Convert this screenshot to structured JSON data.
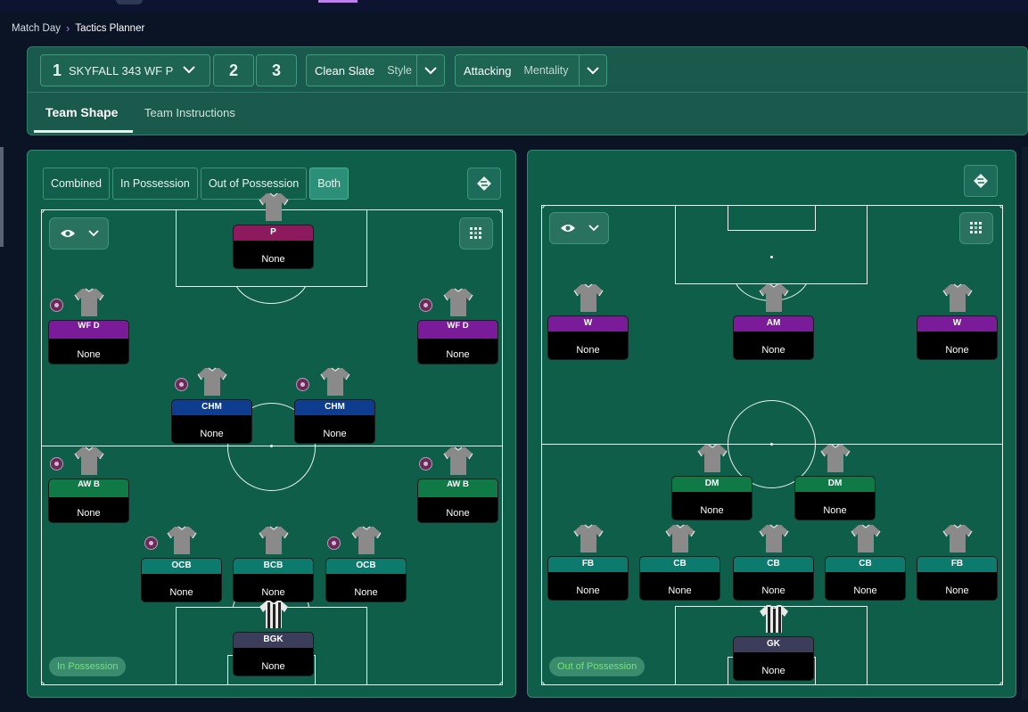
{
  "breadcrumb": {
    "parent": "Match Day",
    "current": "Tactics Planner"
  },
  "tactics": {
    "active_number": "1",
    "active_name": "SKYFALL 343 WF P",
    "slot2": "2",
    "slot3": "3",
    "style_value": "Clean Slate",
    "style_label": "Style",
    "mentality_value": "Attacking",
    "mentality_label": "Mentality"
  },
  "tabs": {
    "team_shape": "Team Shape",
    "team_instructions": "Team Instructions"
  },
  "view_modes": [
    "Combined",
    "In Possession",
    "Out of Possession",
    "Both"
  ],
  "active_view_mode": "Both",
  "left_pitch": {
    "label": "In Possession",
    "players": [
      {
        "role": "P",
        "name": "None",
        "color": "#8e1a5e"
      },
      {
        "role": "WF D",
        "name": "None",
        "color": "#7a1c9a",
        "badge": true
      },
      {
        "role": "WF D",
        "name": "None",
        "color": "#7a1c9a",
        "badge": true
      },
      {
        "role": "CHM",
        "name": "None",
        "color": "#0e3d8f",
        "badge": true
      },
      {
        "role": "CHM",
        "name": "None",
        "color": "#0e3d8f",
        "badge": true
      },
      {
        "role": "AW B",
        "name": "None",
        "color": "#0f7a46",
        "badge": true
      },
      {
        "role": "AW B",
        "name": "None",
        "color": "#0f7a46",
        "badge": true
      },
      {
        "role": "OCB",
        "name": "None",
        "color": "#0c7b6d",
        "badge": true
      },
      {
        "role": "BCB",
        "name": "None",
        "color": "#0c7b6d"
      },
      {
        "role": "OCB",
        "name": "None",
        "color": "#0c7b6d",
        "badge": true
      },
      {
        "role": "BGK",
        "name": "None",
        "color": "#3c3d5a"
      }
    ]
  },
  "right_pitch": {
    "label": "Out of Possession",
    "players": [
      {
        "role": "W",
        "name": "None",
        "color": "#7a1c9a"
      },
      {
        "role": "AM",
        "name": "None",
        "color": "#7a1c9a"
      },
      {
        "role": "W",
        "name": "None",
        "color": "#7a1c9a"
      },
      {
        "role": "DM",
        "name": "None",
        "color": "#0f7a46"
      },
      {
        "role": "DM",
        "name": "None",
        "color": "#0f7a46"
      },
      {
        "role": "FB",
        "name": "None",
        "color": "#0c7b6d"
      },
      {
        "role": "CB",
        "name": "None",
        "color": "#0c7b6d"
      },
      {
        "role": "CB",
        "name": "None",
        "color": "#0c7b6d"
      },
      {
        "role": "CB",
        "name": "None",
        "color": "#0c7b6d"
      },
      {
        "role": "FB",
        "name": "None",
        "color": "#0c7b6d"
      },
      {
        "role": "GK",
        "name": "None",
        "color": "#3c3d5a"
      }
    ]
  },
  "icons": {
    "dropdown": "chevron-down-icon",
    "swap": "swap-icon",
    "eye": "eye-icon",
    "grid": "grid-icon",
    "shirt": "shirt-icon",
    "badge": "trait-badge-icon"
  }
}
